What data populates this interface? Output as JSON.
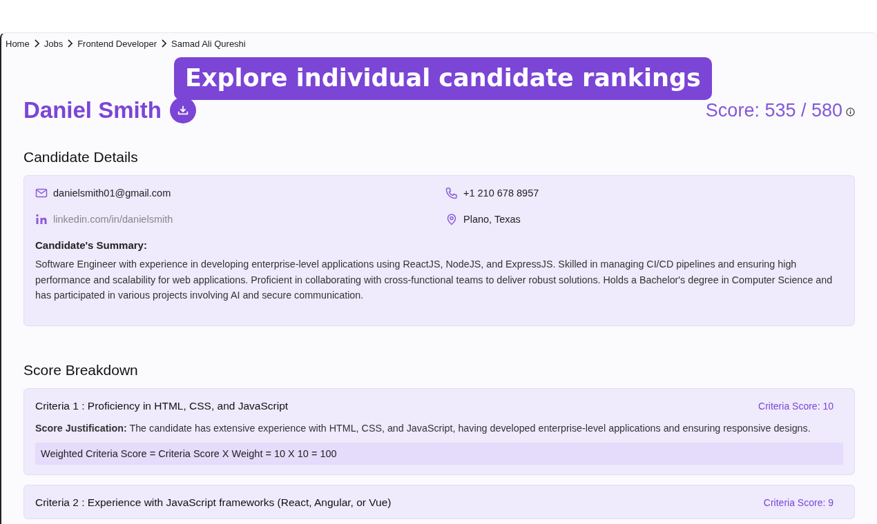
{
  "breadcrumb": [
    {
      "label": "Home"
    },
    {
      "label": "Jobs"
    },
    {
      "label": "Frontend Developer"
    },
    {
      "label": "Samad Ali Qureshi"
    }
  ],
  "banner": {
    "text": "Explore individual candidate rankings"
  },
  "candidate": {
    "name": "Daniel Smith",
    "score": "Score: 535 / 580"
  },
  "details": {
    "heading": "Candidate Details",
    "contacts": [
      {
        "kind": "email",
        "text": "danielsmith01@gmail.com"
      },
      {
        "kind": "phone",
        "text": "+1 210 678 8957"
      },
      {
        "kind": "linkedin",
        "text": "linkedin.com/in/danielsmith"
      },
      {
        "kind": "location",
        "text": "Plano, Texas"
      }
    ],
    "summary_heading": "Candidate's Summary:",
    "summary": "Software Engineer with experience in developing enterprise-level applications using ReactJS, NodeJS, and ExpressJS. Skilled in managing CI/CD pipelines and ensuring high performance and scalability for web applications. Proficient in collaborating with cross-functional teams to deliver robust solutions. Holds a Bachelor's degree in Computer Science and has participated in various projects involving AI and secure communication."
  },
  "breakdown": {
    "heading": "Score Breakdown",
    "criteria": [
      {
        "title": "Criteria 1 : Proficiency in HTML, CSS, and JavaScript",
        "score": "Criteria Score: 10",
        "justification": "**Score Justification:** The candidate has extensive experience with HTML, CSS, and JavaScript, having developed enterprise-level applications and ensuring responsive designs.",
        "formula": "Weighted Criteria Score = Criteria Score X Weight = 10 X 10 = 100"
      },
      {
        "title": "Criteria 2 : Experience with JavaScript frameworks (React, Angular, or Vue)",
        "score": "Criteria Score: 9"
      }
    ]
  }
}
